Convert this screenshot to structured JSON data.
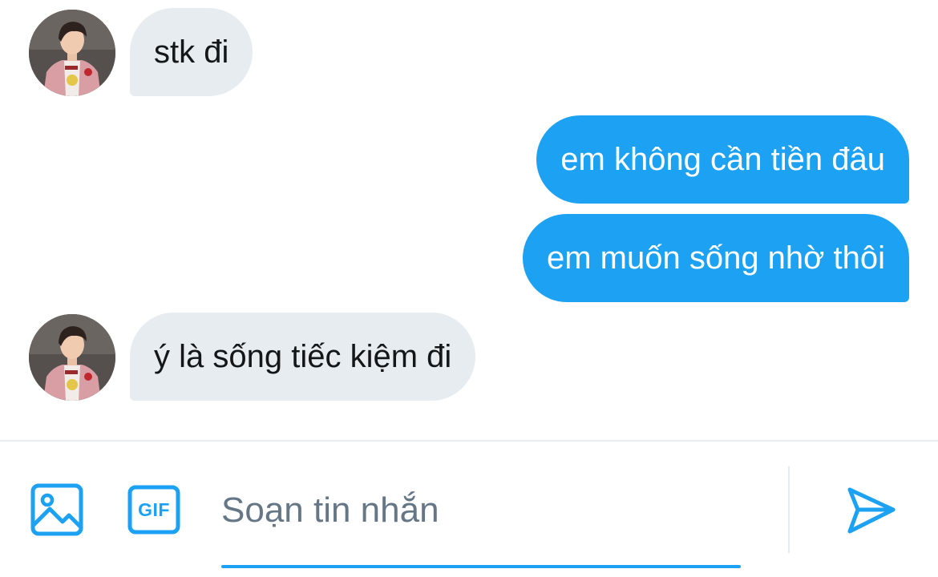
{
  "conversation": {
    "messages": [
      {
        "direction": "in",
        "text": "stk đi",
        "has_avatar": true
      },
      {
        "direction": "out",
        "text": "em không cần tiền đâu"
      },
      {
        "direction": "out",
        "text": "em muốn sống nhờ thôi"
      },
      {
        "direction": "in",
        "text": "ý là sống tiếc kiệm đi",
        "has_avatar": true
      }
    ]
  },
  "composer": {
    "placeholder": "Soạn tin nhắn",
    "gif_label": "GIF",
    "icons": {
      "media": "image-icon",
      "gif": "gif-icon",
      "send": "send-icon"
    }
  },
  "colors": {
    "accent": "#1da1f2",
    "incoming_bubble": "#e6ecf0",
    "incoming_text": "#14171a",
    "outgoing_text": "#ffffff",
    "placeholder": "#657786",
    "divider": "#e6ecf0"
  }
}
